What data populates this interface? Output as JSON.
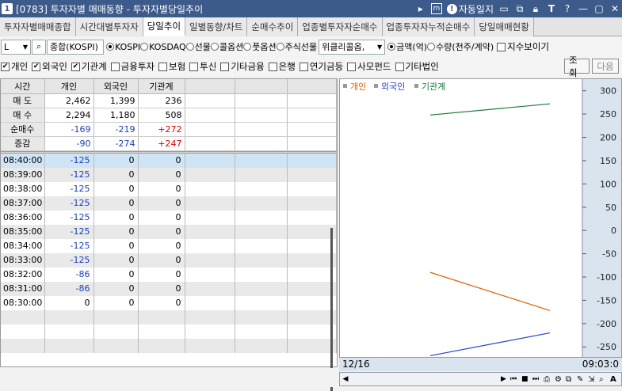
{
  "window": {
    "number": "1",
    "title": "[0783] 투자자별 매매동향 - 투자자별당일추이",
    "journal_label": "자동일지"
  },
  "tabs": [
    "투자자별매매종합",
    "시간대별투자자",
    "당일추이",
    "일별동향/차트",
    "순매수추이",
    "업종별투자자순매수",
    "업종투자자누적순매수",
    "당일매매현황"
  ],
  "active_tab": 2,
  "toolbar": {
    "market_code": "L",
    "index_select": "종합(KOSPI)",
    "markets": [
      {
        "label": "KOSPI",
        "on": true
      },
      {
        "label": "KOSDAQ",
        "on": false
      },
      {
        "label": "선물",
        "on": false
      },
      {
        "label": "콜옵션",
        "on": false
      },
      {
        "label": "풋옵션",
        "on": false
      },
      {
        "label": "주식선물",
        "on": false
      }
    ],
    "weekly_select": "위클리콜옵,",
    "units": [
      {
        "label": "금액(억)",
        "on": true
      },
      {
        "label": "수량(천주/계약)",
        "on": false
      }
    ],
    "index_show": "지수보이기"
  },
  "filters": [
    {
      "label": "개인",
      "checked": true
    },
    {
      "label": "외국인",
      "checked": true
    },
    {
      "label": "기관계",
      "checked": true
    },
    {
      "label": "금융투자",
      "checked": false
    },
    {
      "label": "보험",
      "checked": false
    },
    {
      "label": "투신",
      "checked": false
    },
    {
      "label": "기타금융",
      "checked": false
    },
    {
      "label": "은행",
      "checked": false
    },
    {
      "label": "연기금등",
      "checked": false
    },
    {
      "label": "사모펀드",
      "checked": false
    },
    {
      "label": "기타법인",
      "checked": false
    }
  ],
  "buttons": {
    "query": "조회",
    "next": "다음"
  },
  "grid": {
    "headers": [
      "시간",
      "개인",
      "외국인",
      "기관계"
    ],
    "summary": [
      {
        "label": "매 도",
        "values": [
          "2,462",
          "1,399",
          "236"
        ],
        "colors": [
          "",
          "",
          ""
        ]
      },
      {
        "label": "매 수",
        "values": [
          "2,294",
          "1,180",
          "508"
        ],
        "colors": [
          "",
          "",
          ""
        ]
      },
      {
        "label": "순매수",
        "values": [
          "-169",
          "-219",
          "+272"
        ],
        "colors": [
          "blue",
          "blue",
          "red"
        ]
      },
      {
        "label": "증감",
        "values": [
          "-90",
          "-274",
          "+247"
        ],
        "colors": [
          "blue",
          "blue",
          "red"
        ]
      }
    ],
    "rows": [
      [
        "08:40:00",
        "-125",
        "0",
        "0"
      ],
      [
        "08:39:00",
        "-125",
        "0",
        "0"
      ],
      [
        "08:38:00",
        "-125",
        "0",
        "0"
      ],
      [
        "08:37:00",
        "-125",
        "0",
        "0"
      ],
      [
        "08:36:00",
        "-125",
        "0",
        "0"
      ],
      [
        "08:35:00",
        "-125",
        "0",
        "0"
      ],
      [
        "08:34:00",
        "-125",
        "0",
        "0"
      ],
      [
        "08:33:00",
        "-125",
        "0",
        "0"
      ],
      [
        "08:32:00",
        "-86",
        "0",
        "0"
      ],
      [
        "08:31:00",
        "-86",
        "0",
        "0"
      ],
      [
        "08:30:00",
        "0",
        "0",
        "0"
      ]
    ]
  },
  "chart_data": {
    "type": "line",
    "series": [
      {
        "name": "개인",
        "color": "#e06000",
        "values": [
          -90,
          -172
        ]
      },
      {
        "name": "외국인",
        "color": "#2244d0",
        "values": [
          -269,
          -220
        ]
      },
      {
        "name": "기관계",
        "color": "#1a7a3a",
        "values": [
          248,
          272
        ]
      }
    ],
    "yticks": [
      300,
      250,
      200,
      150,
      100,
      50,
      0,
      -50,
      -100,
      -150,
      -200,
      -250
    ],
    "ylim": [
      -270,
      325
    ],
    "legend": "top-left",
    "date_label": "12/16",
    "time_label": "09:03:0"
  }
}
